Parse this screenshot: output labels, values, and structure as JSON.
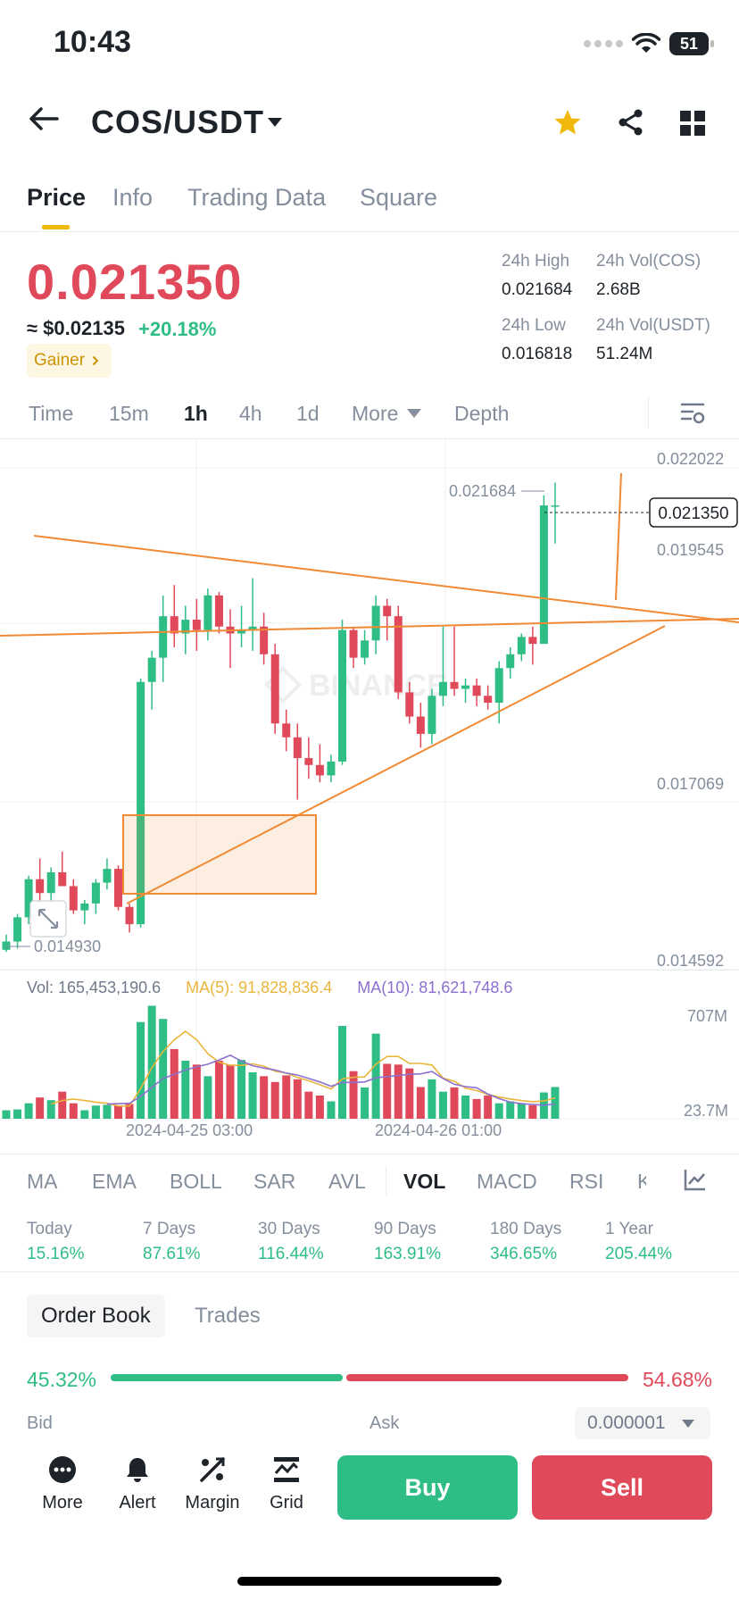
{
  "status_bar": {
    "time": "10:43",
    "battery": "51"
  },
  "header": {
    "pair": "COS/USDT"
  },
  "tabs": [
    "Price",
    "Info",
    "Trading Data",
    "Square"
  ],
  "ticker": {
    "last_price": "0.021350",
    "usd_price": "≈ $0.02135",
    "change": "+20.18%",
    "badge": "Gainer",
    "high_label": "24h High",
    "high_value": "0.021684",
    "vol_base_label": "24h Vol(COS)",
    "vol_base_value": "2.68B",
    "low_label": "24h Low",
    "low_value": "0.016818",
    "vol_quote_label": "24h Vol(USDT)",
    "vol_quote_value": "51.24M"
  },
  "intervals": [
    "Time",
    "15m",
    "1h",
    "4h",
    "1d",
    "More",
    "Depth"
  ],
  "chart": {
    "price_axis": [
      "0.022022",
      "0.019545",
      "0.017069",
      "0.014592"
    ],
    "current_price_tag": "0.021350",
    "high_marker": "0.021684",
    "low_marker": "0.014930",
    "watermark": "BINANCE",
    "volume_axis": [
      "707M",
      "23.7M"
    ],
    "time_axis": [
      "2024-04-25 03:00",
      "2024-04-26 01:00"
    ],
    "vol_legend": {
      "vol": "Vol: 165,453,190.6",
      "ma5": "MA(5): 91,828,836.4",
      "ma10": "MA(10): 81,621,748.6"
    },
    "colors": {
      "up": "#2ebd85",
      "down": "#e0495a",
      "drawing": "#f08a34",
      "ma5": "#e9b53b",
      "ma10": "#8d6fcf"
    }
  },
  "chart_data": {
    "type": "candlestick",
    "ylim": [
      0.014592,
      0.022022
    ],
    "candles": [
      [
        0.01493,
        0.01515,
        0.0149,
        0.01505
      ],
      [
        0.01505,
        0.01545,
        0.01495,
        0.0154
      ],
      [
        0.0154,
        0.016,
        0.0153,
        0.01595
      ],
      [
        0.01595,
        0.01625,
        0.0156,
        0.01575
      ],
      [
        0.01575,
        0.01612,
        0.0156,
        0.01605
      ],
      [
        0.01605,
        0.01635,
        0.01585,
        0.01585
      ],
      [
        0.01585,
        0.01595,
        0.01545,
        0.0155
      ],
      [
        0.0155,
        0.01565,
        0.0153,
        0.0156
      ],
      [
        0.0156,
        0.01595,
        0.01545,
        0.0159
      ],
      [
        0.0159,
        0.01625,
        0.0158,
        0.0161
      ],
      [
        0.0161,
        0.01615,
        0.0155,
        0.01555
      ],
      [
        0.01555,
        0.0156,
        0.01518,
        0.0153
      ],
      [
        0.0153,
        0.01885,
        0.01525,
        0.0188
      ],
      [
        0.0188,
        0.01925,
        0.0184,
        0.01915
      ],
      [
        0.01915,
        0.02005,
        0.0188,
        0.01975
      ],
      [
        0.01975,
        0.0202,
        0.0193,
        0.0195
      ],
      [
        0.0195,
        0.0199,
        0.0192,
        0.0197
      ],
      [
        0.0197,
        0.02,
        0.01925,
        0.01955
      ],
      [
        0.01955,
        0.02015,
        0.0194,
        0.02005
      ],
      [
        0.02005,
        0.0201,
        0.0195,
        0.0196
      ],
      [
        0.0196,
        0.01985,
        0.019,
        0.0195
      ],
      [
        0.0195,
        0.0199,
        0.0193,
        0.01955
      ],
      [
        0.01955,
        0.0203,
        0.01925,
        0.0196
      ],
      [
        0.0196,
        0.0198,
        0.01905,
        0.0192
      ],
      [
        0.0192,
        0.01935,
        0.01805,
        0.0182
      ],
      [
        0.0182,
        0.0184,
        0.0178,
        0.018
      ],
      [
        0.018,
        0.0182,
        0.0171,
        0.0177
      ],
      [
        0.0177,
        0.018,
        0.0174,
        0.0176
      ],
      [
        0.0176,
        0.0179,
        0.01735,
        0.01745
      ],
      [
        0.01745,
        0.01775,
        0.01735,
        0.01765
      ],
      [
        0.01765,
        0.0197,
        0.0176,
        0.01955
      ],
      [
        0.01955,
        0.0196,
        0.019,
        0.01915
      ],
      [
        0.01915,
        0.01955,
        0.01905,
        0.0194
      ],
      [
        0.0194,
        0.02005,
        0.0192,
        0.0199
      ],
      [
        0.0199,
        0.02,
        0.0194,
        0.01975
      ],
      [
        0.01975,
        0.0199,
        0.01855,
        0.01865
      ],
      [
        0.01865,
        0.0188,
        0.0182,
        0.0183
      ],
      [
        0.0183,
        0.0185,
        0.01785,
        0.01805
      ],
      [
        0.01805,
        0.0187,
        0.0179,
        0.0186
      ],
      [
        0.0186,
        0.0196,
        0.01845,
        0.0188
      ],
      [
        0.0188,
        0.0196,
        0.0186,
        0.0187
      ],
      [
        0.0187,
        0.01885,
        0.0185,
        0.01875
      ],
      [
        0.01875,
        0.01885,
        0.01845,
        0.0186
      ],
      [
        0.0186,
        0.01875,
        0.0184,
        0.0185
      ],
      [
        0.0185,
        0.0191,
        0.0182,
        0.019
      ],
      [
        0.019,
        0.0193,
        0.01885,
        0.0192
      ],
      [
        0.0192,
        0.0195,
        0.0191,
        0.01945
      ],
      [
        0.01945,
        0.0196,
        0.01905,
        0.01935
      ],
      [
        0.01935,
        0.0215,
        0.01935,
        0.02135
      ],
      [
        0.02135,
        0.02168,
        0.0208,
        0.02135
      ]
    ],
    "volumes_m": [
      22,
      24,
      40,
      55,
      48,
      70,
      40,
      22,
      34,
      36,
      34,
      38,
      250,
      292,
      258,
      180,
      150,
      140,
      110,
      150,
      140,
      152,
      120,
      110,
      95,
      112,
      102,
      70,
      60,
      45,
      240,
      123,
      81,
      220,
      142,
      140,
      130,
      82,
      102,
      70,
      81,
      60,
      51,
      60,
      40,
      45,
      40,
      35,
      68,
      82
    ],
    "ma5_m": [
      null,
      null,
      null,
      null,
      38,
      47,
      51,
      47,
      43,
      40,
      33,
      33,
      78,
      132,
      174,
      204,
      226,
      204,
      168,
      146,
      138,
      138,
      142,
      136,
      123,
      118,
      107,
      98,
      88,
      77,
      103,
      107,
      108,
      141,
      161,
      161,
      143,
      143,
      139,
      105,
      97,
      79,
      73,
      63,
      56,
      51,
      47,
      44,
      46,
      54
    ],
    "ma10_m": [
      null,
      null,
      null,
      null,
      null,
      null,
      null,
      null,
      null,
      38,
      39,
      40,
      58,
      81,
      104,
      115,
      126,
      134,
      141,
      152,
      164,
      149,
      137,
      131,
      126,
      118,
      113,
      104,
      95,
      84,
      94,
      94,
      95,
      106,
      109,
      112,
      115,
      116,
      122,
      104,
      89,
      83,
      80,
      64,
      52,
      43,
      39,
      37,
      35,
      38
    ],
    "volume_ylim": [
      0,
      300
    ]
  },
  "indicators": [
    "MA",
    "EMA",
    "BOLL",
    "SAR",
    "AVL",
    "VOL",
    "MACD",
    "RSI",
    "K"
  ],
  "performance": [
    {
      "label": "Today",
      "value": "15.16%"
    },
    {
      "label": "7 Days",
      "value": "87.61%"
    },
    {
      "label": "30 Days",
      "value": "116.44%"
    },
    {
      "label": "90 Days",
      "value": "163.91%"
    },
    {
      "label": "180 Days",
      "value": "346.65%"
    },
    {
      "label": "1 Year",
      "value": "205.44%"
    }
  ],
  "orderbook": {
    "tab_active": "Order Book",
    "tab_other": "Trades",
    "bid_pct": "45.32%",
    "ask_pct": "54.68%",
    "bid_label": "Bid",
    "ask_label": "Ask",
    "precision": "0.000001"
  },
  "bottom_nav": {
    "more": "More",
    "alert": "Alert",
    "margin": "Margin",
    "grid": "Grid",
    "buy": "Buy",
    "sell": "Sell"
  }
}
